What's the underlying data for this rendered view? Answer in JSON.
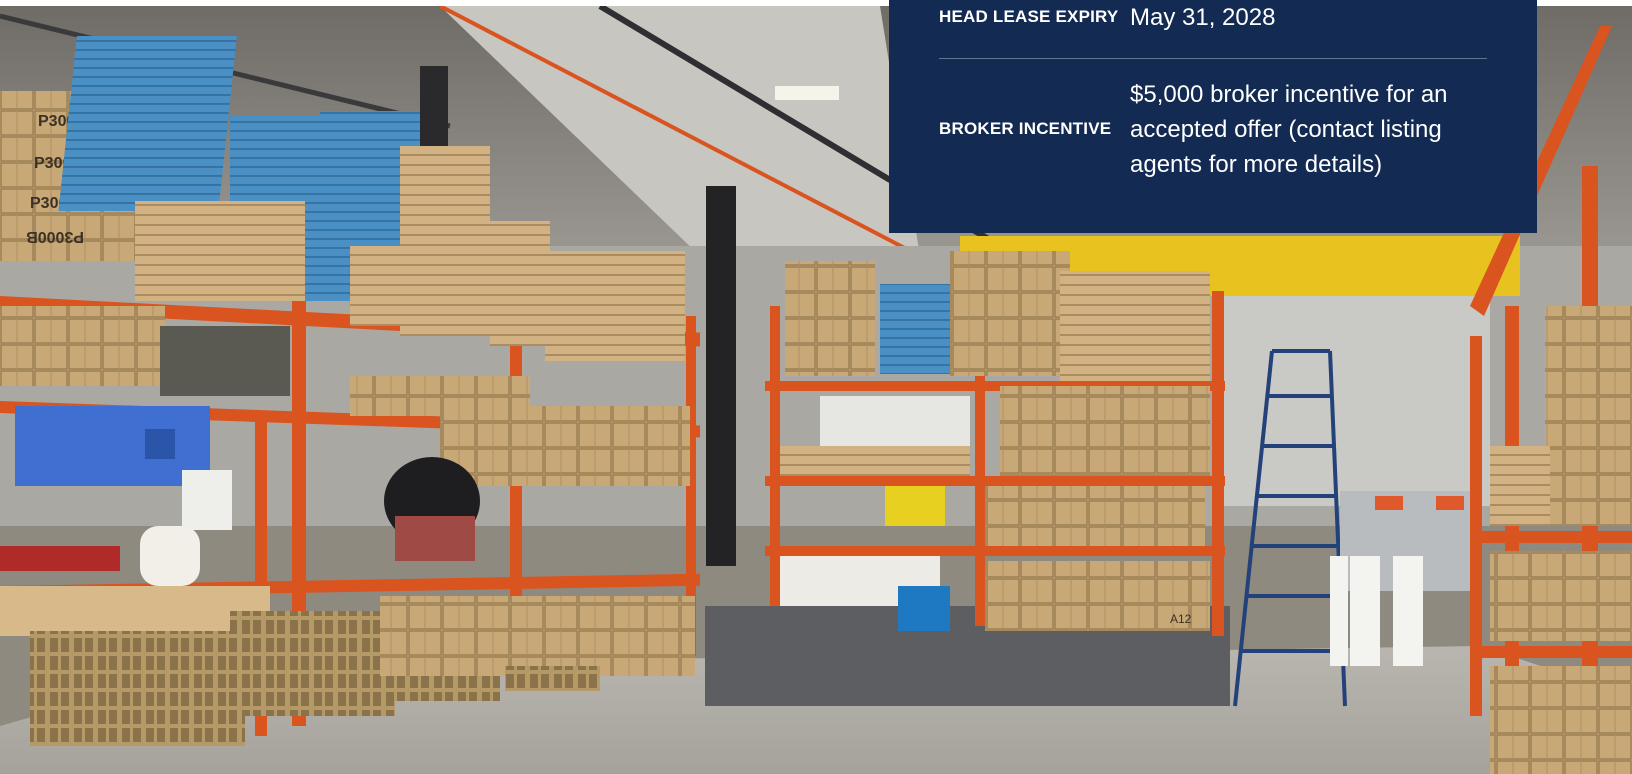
{
  "listing_details": {
    "rows": [
      {
        "label": "HEAD LEASE EXPIRY",
        "value": "May 31, 2028"
      },
      {
        "label": "BROKER INCENTIVE",
        "value": "$5,000 broker incentive for an accepted offer (contact listing agents for more details)"
      }
    ]
  },
  "photo": {
    "box_labels": [
      "P3000B",
      "P3000B",
      "P3000B",
      "P3000B"
    ],
    "carton_label": "A12"
  },
  "colors": {
    "panel_background": "#132a52",
    "panel_text": "#ffffff",
    "racking": "#d9541e",
    "cardboard": "#c9a877",
    "blue_stock": "#4a90c4"
  }
}
